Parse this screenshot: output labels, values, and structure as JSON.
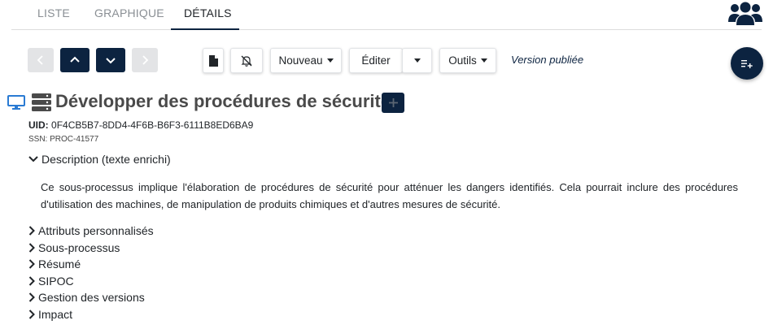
{
  "tabs": [
    {
      "label": "LISTE"
    },
    {
      "label": "GRAPHIQUE"
    },
    {
      "label": "DÉTAILS"
    }
  ],
  "toolbar": {
    "nouveau_label": "Nouveau",
    "editer_label": "Éditer",
    "outils_label": "Outils",
    "version_text": "Version publiée"
  },
  "process": {
    "title": "Développer des procédures de sécurité",
    "uid_label": "UID:",
    "uid_value": "0F4CB5B7-8DD4-4F6B-B6F3-6111B8ED6BA9",
    "ssn": "SSN: PROC-41577"
  },
  "sections": {
    "description": {
      "label": "Description (texte enrichi)",
      "body": "Ce sous-processus implique l'élaboration de procédures de sécurité pour atténuer les dangers identifiés. Cela pourrait inclure des procédures d'utilisation des machines, de manipulation de produits chimiques et d'autres mesures de sécurité."
    },
    "collapsed": [
      {
        "label": "Attributs personnalisés"
      },
      {
        "label": "Sous-processus"
      },
      {
        "label": "Résumé"
      },
      {
        "label": "SIPOC"
      },
      {
        "label": "Gestion des versions"
      },
      {
        "label": "Impact"
      }
    ]
  },
  "colors": {
    "navy": "#0c2340",
    "accent_blue": "#2a7bd3",
    "grey_button": "#e3e4e6"
  }
}
